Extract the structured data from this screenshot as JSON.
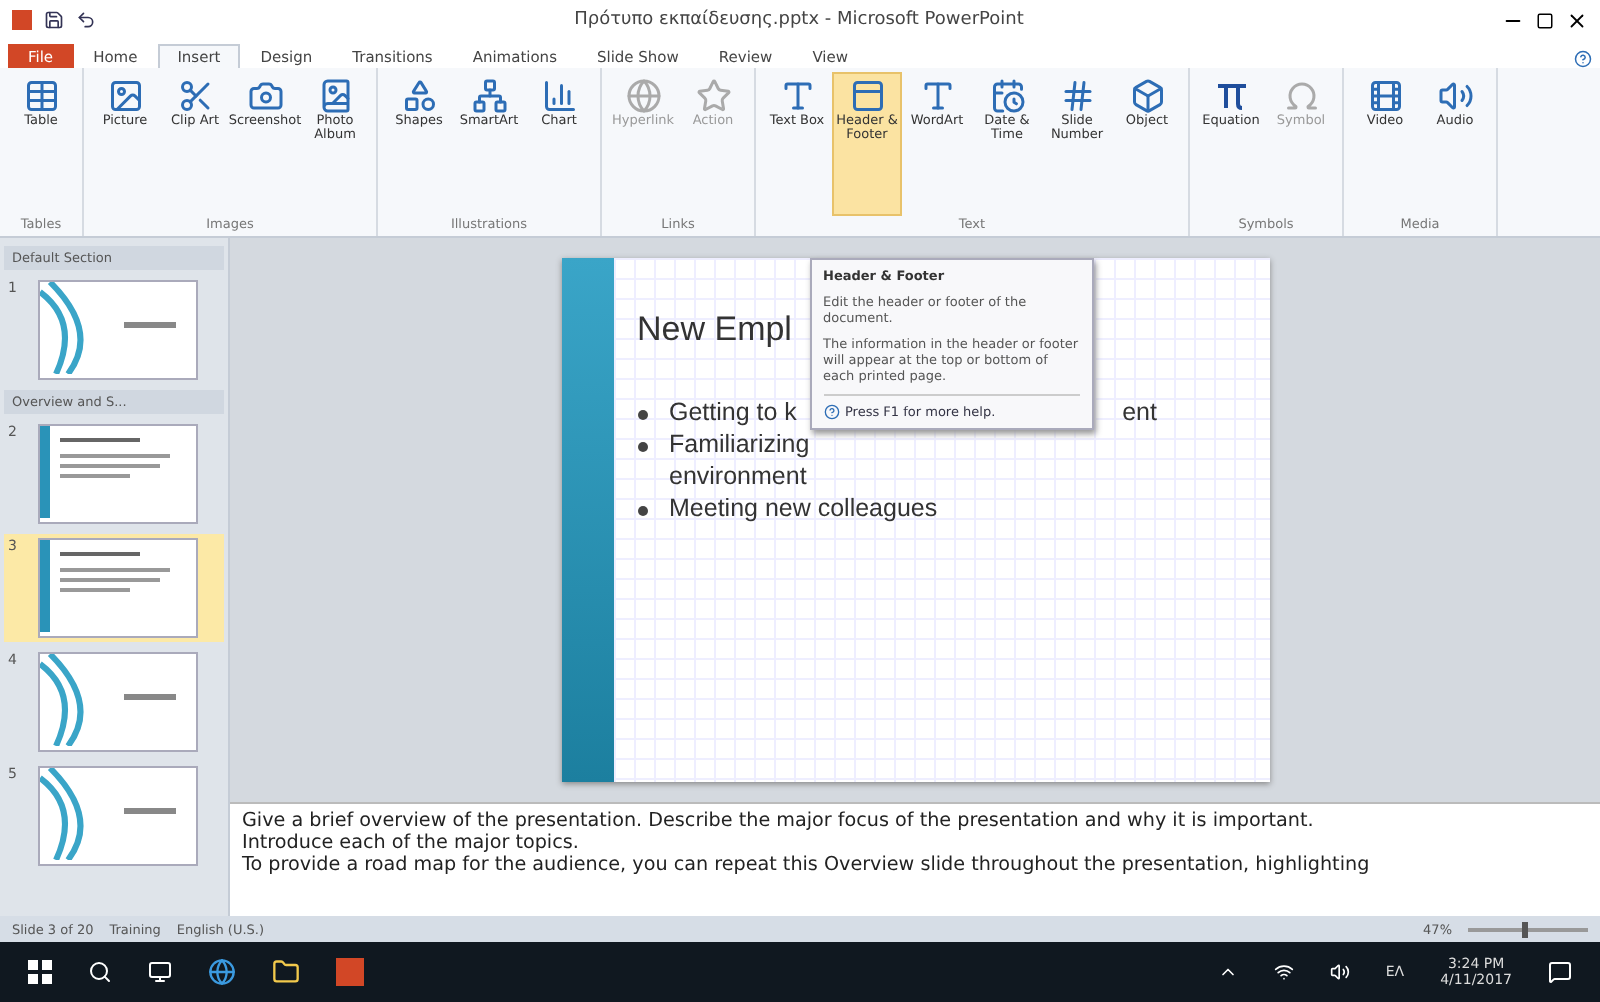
{
  "window": {
    "title": "Πρότυπο εκπαίδευσης.pptx - Microsoft PowerPoint"
  },
  "tabs": [
    {
      "label": "File",
      "kind": "file",
      "selected": false
    },
    {
      "label": "Home",
      "kind": "tab",
      "selected": false
    },
    {
      "label": "Insert",
      "kind": "tab",
      "selected": true
    },
    {
      "label": "Design",
      "kind": "tab",
      "selected": false
    },
    {
      "label": "Transitions",
      "kind": "tab",
      "selected": false
    },
    {
      "label": "Animations",
      "kind": "tab",
      "selected": false
    },
    {
      "label": "Slide Show",
      "kind": "tab",
      "selected": false
    },
    {
      "label": "Review",
      "kind": "tab",
      "selected": false
    },
    {
      "label": "View",
      "kind": "tab",
      "selected": false
    }
  ],
  "ribbon": [
    {
      "group": "Tables",
      "commands": [
        {
          "label": "Table",
          "disabled": false,
          "selected": false
        }
      ]
    },
    {
      "group": "Images",
      "commands": [
        {
          "label": "Picture",
          "disabled": false,
          "selected": false
        },
        {
          "label": "Clip Art",
          "disabled": false,
          "selected": false
        },
        {
          "label": "Screenshot",
          "disabled": false,
          "selected": false
        },
        {
          "label": "Photo Album",
          "disabled": false,
          "selected": false
        }
      ]
    },
    {
      "group": "Illustrations",
      "commands": [
        {
          "label": "Shapes",
          "disabled": false,
          "selected": false
        },
        {
          "label": "SmartArt",
          "disabled": false,
          "selected": false
        },
        {
          "label": "Chart",
          "disabled": false,
          "selected": false
        }
      ]
    },
    {
      "group": "Links",
      "commands": [
        {
          "label": "Hyperlink",
          "disabled": true,
          "selected": false
        },
        {
          "label": "Action",
          "disabled": true,
          "selected": false
        }
      ]
    },
    {
      "group": "Text",
      "commands": [
        {
          "label": "Text Box",
          "disabled": false,
          "selected": false
        },
        {
          "label": "Header & Footer",
          "disabled": false,
          "selected": true
        },
        {
          "label": "WordArt",
          "disabled": false,
          "selected": false
        },
        {
          "label": "Date & Time",
          "disabled": false,
          "selected": false
        },
        {
          "label": "Slide Number",
          "disabled": false,
          "selected": false
        },
        {
          "label": "Object",
          "disabled": false,
          "selected": false
        }
      ]
    },
    {
      "group": "Symbols",
      "commands": [
        {
          "label": "Equation",
          "disabled": false,
          "selected": false
        },
        {
          "label": "Symbol",
          "disabled": true,
          "selected": false
        }
      ]
    },
    {
      "group": "Media",
      "commands": [
        {
          "label": "Video",
          "disabled": false,
          "selected": false
        },
        {
          "label": "Audio",
          "disabled": false,
          "selected": false
        }
      ]
    }
  ],
  "slides_pane": {
    "items": [
      {
        "kind": "section",
        "label": "Default Section"
      },
      {
        "kind": "slide",
        "number": "1",
        "selected": false
      },
      {
        "kind": "section",
        "label": "Overview and S..."
      },
      {
        "kind": "slide_text",
        "number": "2",
        "selected": false
      },
      {
        "kind": "slide_text",
        "number": "3",
        "selected": true
      },
      {
        "kind": "slide",
        "number": "4",
        "selected": false
      },
      {
        "kind": "slide",
        "number": "5",
        "selected": false
      }
    ]
  },
  "slide": {
    "title": "New Empl",
    "bullets": [
      {
        "text": "Getting to k",
        "tail": "ent",
        "kind": "bullet"
      },
      {
        "text": "Familiarizing",
        "kind": "bullet"
      },
      {
        "text": "environment",
        "kind": "continuation"
      },
      {
        "text": "Meeting new colleagues",
        "kind": "bullet"
      }
    ]
  },
  "tooltip": {
    "title": "Header & Footer",
    "lines": [
      "Edit the header or footer of the document.",
      "The information in the header or footer will appear at the top or bottom of each printed page."
    ],
    "help": "Press F1 for more help."
  },
  "notes": [
    "Give a brief overview of the presentation. Describe the major focus of the presentation and why it is important.",
    "Introduce each of the major topics.",
    "To provide a road map for the audience, you can repeat this Overview slide throughout the presentation, highlighting"
  ],
  "status_bar": {
    "slide": "Slide 3 of 20",
    "theme": "Training",
    "language": "English (U.S.)",
    "zoom": "47%",
    "zoom_slider": {
      "level": 0.45
    }
  },
  "taskbar": {
    "language": "ΕΛ",
    "time": "3:24 PM",
    "date": "4/11/2017"
  }
}
